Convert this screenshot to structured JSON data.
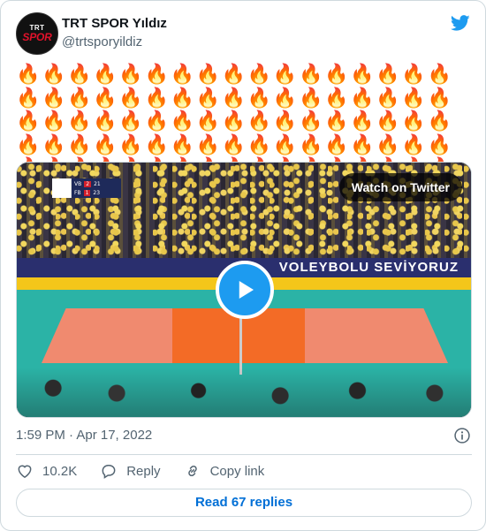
{
  "author": {
    "name": "TRT SPOR Yıldız",
    "handle": "@trtsporyildiz",
    "avatar_top": "TRT",
    "avatar_bottom": "SPOR"
  },
  "tweet": {
    "text": "🔥🔥🔥🔥🔥🔥🔥🔥🔥🔥🔥🔥🔥🔥🔥🔥🔥🔥🔥🔥🔥🔥🔥🔥🔥🔥🔥🔥🔥🔥🔥🔥🔥🔥🔥🔥🔥🔥🔥🔥🔥🔥🔥🔥🔥🔥🔥🔥🔥🔥🔥🔥🔥🔥🔥🔥🔥🔥🔥🔥🔥🔥🔥🔥🔥🔥🔥🔥🔥🔥🔥🔥🔥🔥🔥🔥🔥🔥🔥🔥🔥🔥🔥🔥🔥🔥🔥"
  },
  "media": {
    "watch_label": "Watch on Twitter",
    "banner_text": "VOLEYBOLU SEVİYORUZ",
    "scoreboard": {
      "team1": "VB",
      "team1_sets": "2",
      "team1_points": "21",
      "team2": "FB",
      "team2_sets": "1",
      "team2_points": "23"
    }
  },
  "meta": {
    "timestamp": "1:59 PM · Apr 17, 2022"
  },
  "actions": {
    "like_count": "10.2K",
    "reply_label": "Reply",
    "copy_label": "Copy link"
  },
  "replies_button": "Read 67 replies",
  "colors": {
    "brand_blue": "#1d9bf0",
    "link_blue": "#006fd6",
    "secondary_text": "#536471",
    "border": "#cfd9de"
  },
  "icons": [
    "twitter-bird-icon",
    "play-icon",
    "info-icon",
    "heart-icon",
    "reply-bubble-icon",
    "link-icon"
  ]
}
